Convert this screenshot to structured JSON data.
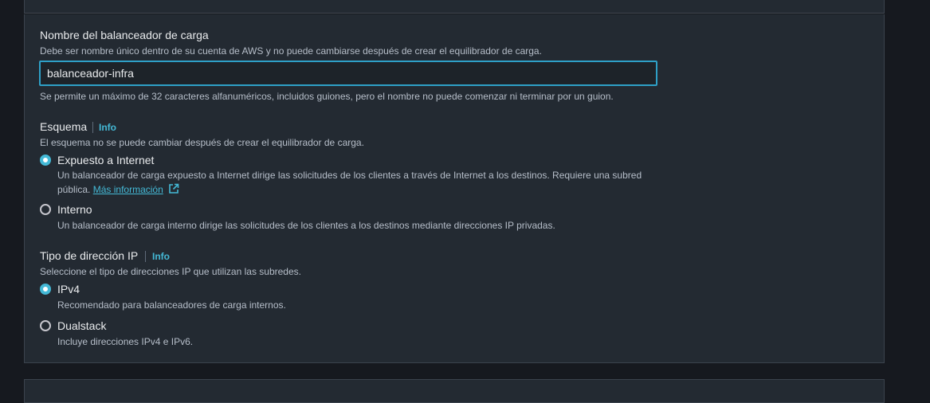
{
  "lb_name": {
    "label": "Nombre del balanceador de carga",
    "description": "Debe ser nombre único dentro de su cuenta de AWS y no puede cambiarse después de crear el equilibrador de carga.",
    "value": "balanceador-infra",
    "constraint": "Se permite un máximo de 32 caracteres alfanuméricos, incluidos guiones, pero el nombre no puede comenzar ni terminar por un guion."
  },
  "scheme": {
    "label": "Esquema",
    "info": "Info",
    "description": "El esquema no se puede cambiar después de crear el equilibrador de carga.",
    "options": [
      {
        "label": "Expuesto a Internet",
        "checked": true,
        "desc_line1": "Un balanceador de carga expuesto a Internet dirige las solicitudes de los clientes a través de Internet a los destinos. Requiere una subred",
        "desc_line2_prefix": "pública.",
        "link": "Más información"
      },
      {
        "label": "Interno",
        "checked": false,
        "desc": "Un balanceador de carga interno dirige las solicitudes de los clientes a los destinos mediante direcciones IP privadas."
      }
    ]
  },
  "ip_type": {
    "label": "Tipo de dirección IP",
    "info": "Info",
    "description": "Seleccione el tipo de direcciones IP que utilizan las subredes.",
    "options": [
      {
        "label": "IPv4",
        "checked": true,
        "desc": "Recomendado para balanceadores de carga internos."
      },
      {
        "label": "Dualstack",
        "checked": false,
        "desc": "Incluye direcciones IPv4 e IPv6."
      }
    ]
  },
  "colors": {
    "accent": "#44b9d6",
    "focus_border": "#2ea0c7",
    "panel_bg": "#232a32",
    "page_bg": "#16191f"
  }
}
